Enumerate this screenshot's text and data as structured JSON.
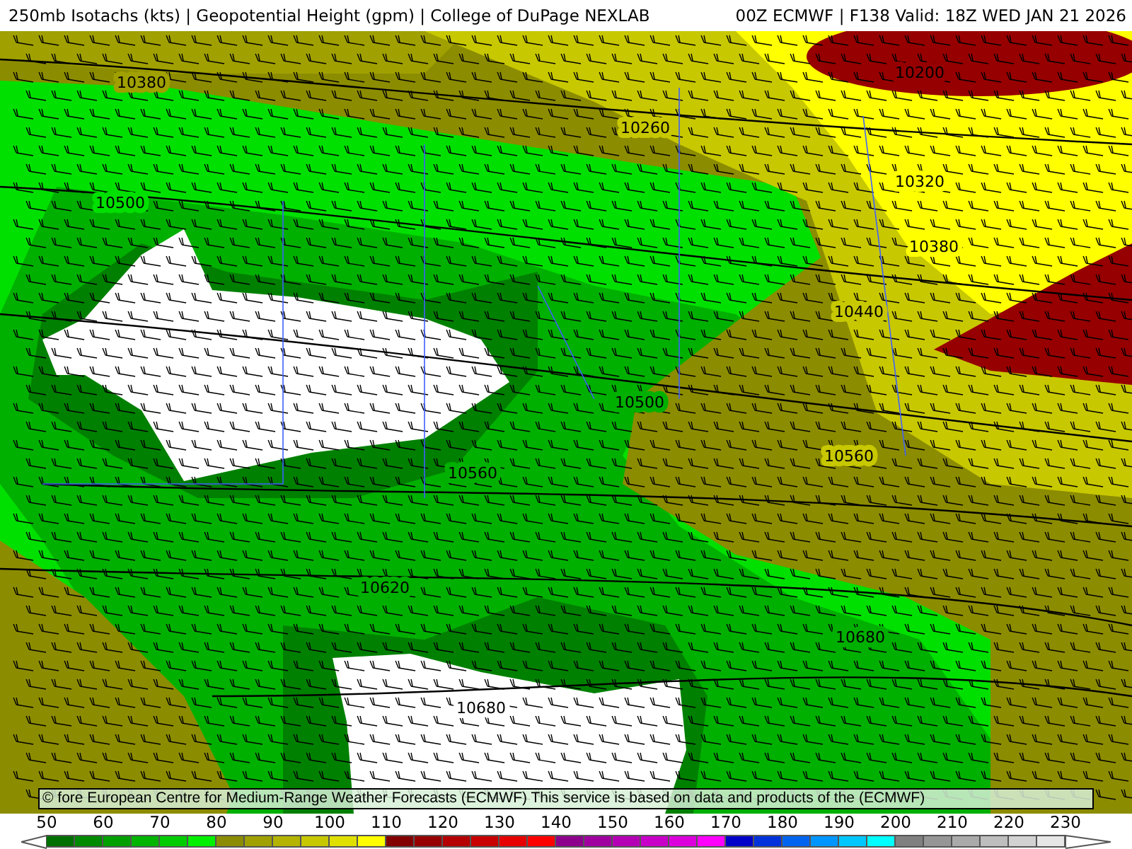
{
  "header": {
    "title": "250mb Isotachs (kts) | Geopotential Height (gpm) | College of DuPage NEXLAB",
    "run": "00Z ECMWF | F138 Valid: 18Z WED JAN 21 2026"
  },
  "map": {
    "contour_labels": [
      {
        "text": "10380"
      },
      {
        "text": "10260"
      },
      {
        "text": "10200"
      },
      {
        "text": "10320"
      },
      {
        "text": "10500"
      },
      {
        "text": "10380"
      },
      {
        "text": "10440"
      },
      {
        "text": "10500"
      },
      {
        "text": "10560"
      },
      {
        "text": "10560"
      },
      {
        "text": "10620"
      },
      {
        "text": "10680"
      },
      {
        "text": "10680"
      }
    ],
    "credit": "© fore European Centre for Medium-Range Weather Forecasts (ECMWF)  This service is based on data and products of the (ECMWF)"
  },
  "colorbar": {
    "labels": [
      "50",
      "60",
      "70",
      "80",
      "90",
      "100",
      "110",
      "120",
      "130",
      "140",
      "150",
      "160",
      "170",
      "180",
      "190",
      "200",
      "210",
      "220",
      "230"
    ],
    "bins": [
      {
        "color": "#007000"
      },
      {
        "color": "#008a00"
      },
      {
        "color": "#00a000"
      },
      {
        "color": "#00b400"
      },
      {
        "color": "#00cc00"
      },
      {
        "color": "#00f000"
      },
      {
        "color": "#8c8c00"
      },
      {
        "color": "#a0a000"
      },
      {
        "color": "#b4b400"
      },
      {
        "color": "#c8c800"
      },
      {
        "color": "#e0e000"
      },
      {
        "color": "#ffff00"
      },
      {
        "color": "#820000"
      },
      {
        "color": "#960000"
      },
      {
        "color": "#b40000"
      },
      {
        "color": "#c80000"
      },
      {
        "color": "#e60000"
      },
      {
        "color": "#ff0000"
      },
      {
        "color": "#8c008c"
      },
      {
        "color": "#a000a0"
      },
      {
        "color": "#b400b4"
      },
      {
        "color": "#c800c8"
      },
      {
        "color": "#dc00dc"
      },
      {
        "color": "#ff00ff"
      },
      {
        "color": "#0000c8"
      },
      {
        "color": "#0032dc"
      },
      {
        "color": "#0064f0"
      },
      {
        "color": "#0096ff"
      },
      {
        "color": "#00c8ff"
      },
      {
        "color": "#00ffff"
      },
      {
        "color": "#808080"
      },
      {
        "color": "#969696"
      },
      {
        "color": "#aaaaaa"
      },
      {
        "color": "#bebebe"
      },
      {
        "color": "#d2d2d2"
      },
      {
        "color": "#e6e6e6"
      }
    ]
  }
}
